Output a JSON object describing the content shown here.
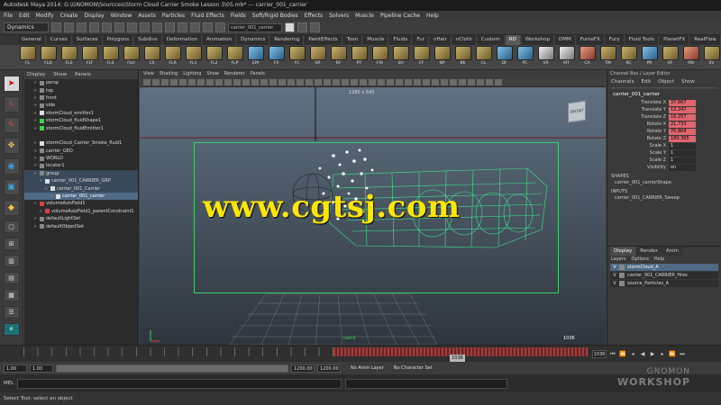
{
  "window": {
    "title": "Autodesk Maya 2014: G:\\GNOMON\\Sourcces\\Storm Cloud Carrier Smoke Lesson 3\\05.mb* --- carrier_001_carrier"
  },
  "menubar": [
    "File",
    "Edit",
    "Modify",
    "Create",
    "Display",
    "Window",
    "Assets",
    "Particles",
    "Fluid Effects",
    "Fields",
    "Soft/Rigid Bodies",
    "Effects",
    "Solvers",
    "Muscle",
    "Pipeline Cache",
    "Help"
  ],
  "statusline": {
    "mode": "Dynamics",
    "field": "carrier_001_carrier"
  },
  "shelf_tabs": [
    "General",
    "Curves",
    "Surfaces",
    "Polygons",
    "Subdivs",
    "Deformation",
    "Animation",
    "Dynamics",
    "Rendering",
    "PaintEffects",
    "Toon",
    "Muscle",
    "Fluids",
    "Fur",
    "nHair",
    "nCloth",
    "Custom",
    "RD",
    "Workshop",
    "DMM",
    "FumeFX",
    "Fury",
    "Fluid Tools",
    "PlanetFX",
    "RealFlow"
  ],
  "shelf_tabs_active": 17,
  "shelf_buttons": [
    {
      "label": "FL",
      "color": "gold"
    },
    {
      "label": "FLD",
      "color": "gold"
    },
    {
      "label": "FLE",
      "color": "gold"
    },
    {
      "label": "FLT",
      "color": "gold"
    },
    {
      "label": "FLS",
      "color": "gold"
    },
    {
      "label": "FLO",
      "color": "gold"
    },
    {
      "label": "CS",
      "color": "gold"
    },
    {
      "label": "FLR",
      "color": "gold"
    },
    {
      "label": "FL1",
      "color": "gold"
    },
    {
      "label": "FL2",
      "color": "gold"
    },
    {
      "label": "FLP",
      "color": "gold"
    },
    {
      "label": "EM",
      "color": "blue"
    },
    {
      "label": "FX",
      "color": "blue"
    },
    {
      "label": "FC",
      "color": "gold"
    },
    {
      "label": "SR",
      "color": "gold"
    },
    {
      "label": "RF",
      "color": "gold"
    },
    {
      "label": "PT",
      "color": "gold"
    },
    {
      "label": "FIX",
      "color": "gold"
    },
    {
      "label": "SH",
      "color": "gold"
    },
    {
      "label": "CF",
      "color": "gold"
    },
    {
      "label": "NP",
      "color": "gold"
    },
    {
      "label": "BK",
      "color": "gold"
    },
    {
      "label": "CL",
      "color": "gold"
    },
    {
      "label": "DF",
      "color": "blue"
    },
    {
      "label": "PC",
      "color": "blue"
    },
    {
      "label": "VR",
      "color": "white"
    },
    {
      "label": "MT",
      "color": "white"
    },
    {
      "label": "CA",
      "color": "red"
    },
    {
      "label": "TM",
      "color": "gold"
    },
    {
      "label": "RC",
      "color": "gold"
    },
    {
      "label": "PR",
      "color": "blue"
    },
    {
      "label": "XF",
      "color": "gold"
    },
    {
      "label": "RN",
      "color": "red"
    },
    {
      "label": "SV",
      "color": "gold"
    }
  ],
  "outliner": {
    "menu": [
      "Display",
      "Show",
      "Panels"
    ],
    "rows": [
      {
        "label": "persp",
        "indent": 1,
        "icon": "gray"
      },
      {
        "label": "top",
        "indent": 1,
        "icon": "gray"
      },
      {
        "label": "front",
        "indent": 1,
        "icon": "gray"
      },
      {
        "label": "side",
        "indent": 1,
        "icon": "gray"
      },
      {
        "label": "stormCloud_emitter1",
        "indent": 1,
        "icon": "white"
      },
      {
        "label": "stormCloud_fluidShape1",
        "indent": 1,
        "icon": "green"
      },
      {
        "label": "stormCloud_fluidEmitter1",
        "indent": 1,
        "icon": "green"
      },
      {
        "label": "",
        "indent": 1,
        "icon": "none"
      },
      {
        "label": "stormCloud_Carrier_Smoke_fluid1",
        "indent": 1,
        "icon": "white"
      },
      {
        "label": "carrier_GEO",
        "indent": 1,
        "icon": "gray"
      },
      {
        "label": "WORLD",
        "indent": 1,
        "icon": "gray"
      },
      {
        "label": "locator1",
        "indent": 1,
        "icon": "gray"
      },
      {
        "label": "group",
        "indent": 1,
        "icon": "gray",
        "state": "hover"
      },
      {
        "label": "carrier_001_CARRIER_GRP",
        "indent": 2,
        "icon": "white",
        "state": "hover"
      },
      {
        "label": "carrier_001_Carrier",
        "indent": 3,
        "icon": "white",
        "state": "hover"
      },
      {
        "label": "carrier_001_carrier",
        "indent": 4,
        "icon": "white",
        "state": "sel"
      },
      {
        "label": "volumeAxisField1",
        "indent": 1,
        "icon": "red"
      },
      {
        "label": "volumeAxisField1_parentConstraint1",
        "indent": 2,
        "icon": "red"
      },
      {
        "label": "defaultLightSet",
        "indent": 1,
        "icon": "gray"
      },
      {
        "label": "defaultObjectSet",
        "indent": 1,
        "icon": "gray"
      }
    ]
  },
  "viewport": {
    "menu": [
      "View",
      "Shading",
      "Lighting",
      "Show",
      "Renderer",
      "Panels"
    ],
    "resolution": "1280 x 545",
    "cube_label": "FRONT",
    "fps": "1036",
    "camera_label": "cam1",
    "watermark": "www.cgtsj.com"
  },
  "channelbox": {
    "title": "Channel Box / Layer Editor",
    "menu": [
      "Channels",
      "Edit",
      "Object",
      "Show"
    ],
    "object": "carrier_001_carrier",
    "channels": [
      {
        "name": "Translate X",
        "value": "37.867",
        "keyed": true
      },
      {
        "name": "Translate Y",
        "value": "12.247",
        "keyed": true
      },
      {
        "name": "Translate Z",
        "value": "16.257",
        "keyed": true
      },
      {
        "name": "Rotate X",
        "value": "21.733",
        "keyed": true
      },
      {
        "name": "Rotate Y",
        "value": "70.864",
        "keyed": true
      },
      {
        "name": "Rotate Z",
        "value": "180.365",
        "keyed": true
      },
      {
        "name": "Scale X",
        "value": "1",
        "keyed": false
      },
      {
        "name": "Scale Y",
        "value": "1",
        "keyed": false
      },
      {
        "name": "Scale Z",
        "value": "1",
        "keyed": false
      },
      {
        "name": "Visibility",
        "value": "on",
        "keyed": false
      }
    ],
    "shapes_header": "SHAPES",
    "shape_node": "carrier_001_carrierShape",
    "inputs_header": "INPUTS",
    "input_node": "carrier_001_CARRIER_Sweep"
  },
  "layereditor": {
    "tabs": [
      "Display",
      "Render",
      "Anim"
    ],
    "active_tab": 0,
    "menu": [
      "Layers",
      "Options",
      "Help"
    ],
    "layers": [
      {
        "vis": "V",
        "label": "stormCloud_A",
        "sel": true
      },
      {
        "vis": "V",
        "label": "carrier_001_CARRIER_Hres",
        "sel": false
      },
      {
        "vis": "V",
        "label": "source_Particles_A",
        "sel": false
      }
    ]
  },
  "timeline": {
    "current_frame": "1036",
    "start": "1.00",
    "end": "1.00",
    "range_start": "1.00",
    "range_end": "1200.00",
    "anim_layer": "No Anim Layer",
    "char_set": "No Character Set"
  },
  "cmdline": {
    "label": "MEL"
  },
  "helpline": {
    "text": "Select Tool: select an object"
  },
  "brand": {
    "line1": "GNOMON",
    "line2": "WORKSHOP"
  }
}
